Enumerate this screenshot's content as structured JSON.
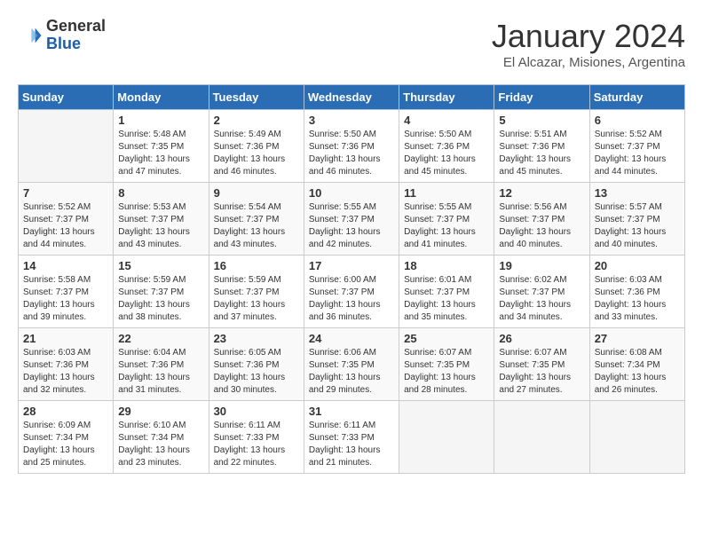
{
  "header": {
    "logo_general": "General",
    "logo_blue": "Blue",
    "month_title": "January 2024",
    "subtitle": "El Alcazar, Misiones, Argentina"
  },
  "weekdays": [
    "Sunday",
    "Monday",
    "Tuesday",
    "Wednesday",
    "Thursday",
    "Friday",
    "Saturday"
  ],
  "weeks": [
    [
      {
        "day": "",
        "sunrise": "",
        "sunset": "",
        "daylight": ""
      },
      {
        "day": "1",
        "sunrise": "Sunrise: 5:48 AM",
        "sunset": "Sunset: 7:35 PM",
        "daylight": "Daylight: 13 hours and 47 minutes."
      },
      {
        "day": "2",
        "sunrise": "Sunrise: 5:49 AM",
        "sunset": "Sunset: 7:36 PM",
        "daylight": "Daylight: 13 hours and 46 minutes."
      },
      {
        "day": "3",
        "sunrise": "Sunrise: 5:50 AM",
        "sunset": "Sunset: 7:36 PM",
        "daylight": "Daylight: 13 hours and 46 minutes."
      },
      {
        "day": "4",
        "sunrise": "Sunrise: 5:50 AM",
        "sunset": "Sunset: 7:36 PM",
        "daylight": "Daylight: 13 hours and 45 minutes."
      },
      {
        "day": "5",
        "sunrise": "Sunrise: 5:51 AM",
        "sunset": "Sunset: 7:36 PM",
        "daylight": "Daylight: 13 hours and 45 minutes."
      },
      {
        "day": "6",
        "sunrise": "Sunrise: 5:52 AM",
        "sunset": "Sunset: 7:37 PM",
        "daylight": "Daylight: 13 hours and 44 minutes."
      }
    ],
    [
      {
        "day": "7",
        "sunrise": "Sunrise: 5:52 AM",
        "sunset": "Sunset: 7:37 PM",
        "daylight": "Daylight: 13 hours and 44 minutes."
      },
      {
        "day": "8",
        "sunrise": "Sunrise: 5:53 AM",
        "sunset": "Sunset: 7:37 PM",
        "daylight": "Daylight: 13 hours and 43 minutes."
      },
      {
        "day": "9",
        "sunrise": "Sunrise: 5:54 AM",
        "sunset": "Sunset: 7:37 PM",
        "daylight": "Daylight: 13 hours and 43 minutes."
      },
      {
        "day": "10",
        "sunrise": "Sunrise: 5:55 AM",
        "sunset": "Sunset: 7:37 PM",
        "daylight": "Daylight: 13 hours and 42 minutes."
      },
      {
        "day": "11",
        "sunrise": "Sunrise: 5:55 AM",
        "sunset": "Sunset: 7:37 PM",
        "daylight": "Daylight: 13 hours and 41 minutes."
      },
      {
        "day": "12",
        "sunrise": "Sunrise: 5:56 AM",
        "sunset": "Sunset: 7:37 PM",
        "daylight": "Daylight: 13 hours and 40 minutes."
      },
      {
        "day": "13",
        "sunrise": "Sunrise: 5:57 AM",
        "sunset": "Sunset: 7:37 PM",
        "daylight": "Daylight: 13 hours and 40 minutes."
      }
    ],
    [
      {
        "day": "14",
        "sunrise": "Sunrise: 5:58 AM",
        "sunset": "Sunset: 7:37 PM",
        "daylight": "Daylight: 13 hours and 39 minutes."
      },
      {
        "day": "15",
        "sunrise": "Sunrise: 5:59 AM",
        "sunset": "Sunset: 7:37 PM",
        "daylight": "Daylight: 13 hours and 38 minutes."
      },
      {
        "day": "16",
        "sunrise": "Sunrise: 5:59 AM",
        "sunset": "Sunset: 7:37 PM",
        "daylight": "Daylight: 13 hours and 37 minutes."
      },
      {
        "day": "17",
        "sunrise": "Sunrise: 6:00 AM",
        "sunset": "Sunset: 7:37 PM",
        "daylight": "Daylight: 13 hours and 36 minutes."
      },
      {
        "day": "18",
        "sunrise": "Sunrise: 6:01 AM",
        "sunset": "Sunset: 7:37 PM",
        "daylight": "Daylight: 13 hours and 35 minutes."
      },
      {
        "day": "19",
        "sunrise": "Sunrise: 6:02 AM",
        "sunset": "Sunset: 7:37 PM",
        "daylight": "Daylight: 13 hours and 34 minutes."
      },
      {
        "day": "20",
        "sunrise": "Sunrise: 6:03 AM",
        "sunset": "Sunset: 7:36 PM",
        "daylight": "Daylight: 13 hours and 33 minutes."
      }
    ],
    [
      {
        "day": "21",
        "sunrise": "Sunrise: 6:03 AM",
        "sunset": "Sunset: 7:36 PM",
        "daylight": "Daylight: 13 hours and 32 minutes."
      },
      {
        "day": "22",
        "sunrise": "Sunrise: 6:04 AM",
        "sunset": "Sunset: 7:36 PM",
        "daylight": "Daylight: 13 hours and 31 minutes."
      },
      {
        "day": "23",
        "sunrise": "Sunrise: 6:05 AM",
        "sunset": "Sunset: 7:36 PM",
        "daylight": "Daylight: 13 hours and 30 minutes."
      },
      {
        "day": "24",
        "sunrise": "Sunrise: 6:06 AM",
        "sunset": "Sunset: 7:35 PM",
        "daylight": "Daylight: 13 hours and 29 minutes."
      },
      {
        "day": "25",
        "sunrise": "Sunrise: 6:07 AM",
        "sunset": "Sunset: 7:35 PM",
        "daylight": "Daylight: 13 hours and 28 minutes."
      },
      {
        "day": "26",
        "sunrise": "Sunrise: 6:07 AM",
        "sunset": "Sunset: 7:35 PM",
        "daylight": "Daylight: 13 hours and 27 minutes."
      },
      {
        "day": "27",
        "sunrise": "Sunrise: 6:08 AM",
        "sunset": "Sunset: 7:34 PM",
        "daylight": "Daylight: 13 hours and 26 minutes."
      }
    ],
    [
      {
        "day": "28",
        "sunrise": "Sunrise: 6:09 AM",
        "sunset": "Sunset: 7:34 PM",
        "daylight": "Daylight: 13 hours and 25 minutes."
      },
      {
        "day": "29",
        "sunrise": "Sunrise: 6:10 AM",
        "sunset": "Sunset: 7:34 PM",
        "daylight": "Daylight: 13 hours and 23 minutes."
      },
      {
        "day": "30",
        "sunrise": "Sunrise: 6:11 AM",
        "sunset": "Sunset: 7:33 PM",
        "daylight": "Daylight: 13 hours and 22 minutes."
      },
      {
        "day": "31",
        "sunrise": "Sunrise: 6:11 AM",
        "sunset": "Sunset: 7:33 PM",
        "daylight": "Daylight: 13 hours and 21 minutes."
      },
      {
        "day": "",
        "sunrise": "",
        "sunset": "",
        "daylight": ""
      },
      {
        "day": "",
        "sunrise": "",
        "sunset": "",
        "daylight": ""
      },
      {
        "day": "",
        "sunrise": "",
        "sunset": "",
        "daylight": ""
      }
    ]
  ]
}
